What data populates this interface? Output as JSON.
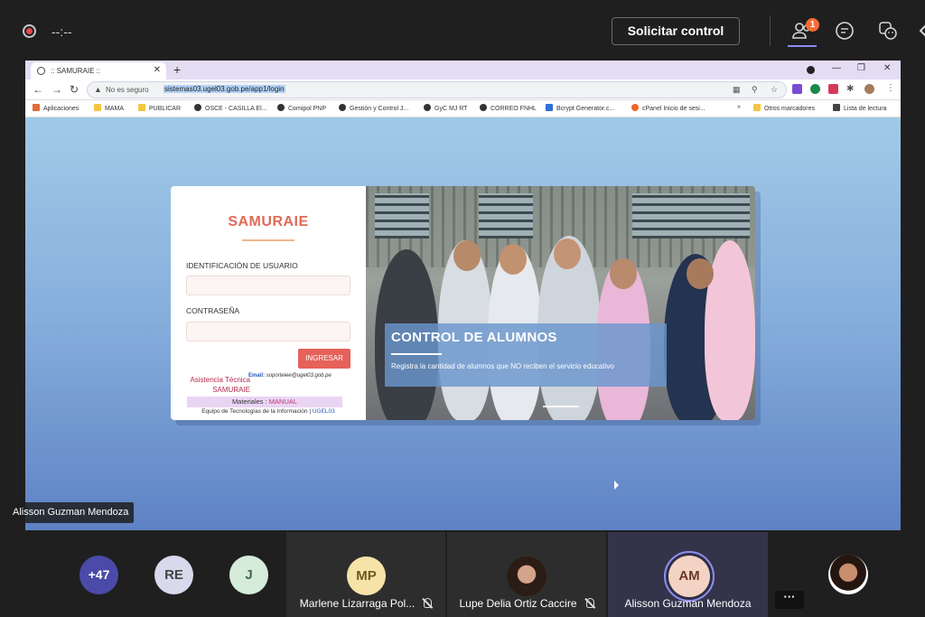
{
  "teams": {
    "timer": "--:--",
    "request_control_label": "Solicitar control",
    "participants_badge": "1"
  },
  "browser": {
    "tab_title": ":: SAMURAIE ::",
    "security_label": "No es seguro",
    "url": "sistemas03.ugel03.gob.pe/app1/login",
    "bookmarks": [
      "Aplicaciones",
      "MAMA",
      "PUBLICAR",
      "OSCE - CASILLA El...",
      "Comipol PNP",
      "Gestión y Control J...",
      "GyC MJ RT",
      "CORREO FNHL",
      "Bcrypt Generator.c...",
      "cPanel Inicio de sesi...",
      "Otros marcadores",
      "Lista de lectura"
    ]
  },
  "login": {
    "brand": "SAMURAIE",
    "user_label": "IDENTIFICACIÓN DE USUARIO",
    "password_label": "CONTRASEÑA",
    "submit_label": "INGRESAR",
    "help_text": "Asistencia Técnica SAMURAIE",
    "email_prefix": "Email:",
    "email": "soporteiee@ugel03.gob.pe",
    "materials_prefix": "Materiales :",
    "materials_link": "MANUAL",
    "team_text": "Equipo de Tecnologías de la Información |",
    "team_link": "UGEL03"
  },
  "banner": {
    "title": "CONTROL DE ALUMNOS",
    "subtitle": "Registra la cantidad de alumnos que NO reciben el servicio educativo"
  },
  "presenter_name": "Alisson Guzman Mendoza",
  "participants": {
    "overflow": "+47",
    "initials": [
      "RE",
      "J"
    ],
    "tiles": [
      {
        "initials": "MP",
        "name": "Marlene Lizarraga Pol..."
      },
      {
        "name": "Lupe Delia Ortiz Caccire"
      },
      {
        "initials": "AM",
        "name": "Alisson Guzman Mendoza"
      }
    ],
    "more": "···"
  }
}
